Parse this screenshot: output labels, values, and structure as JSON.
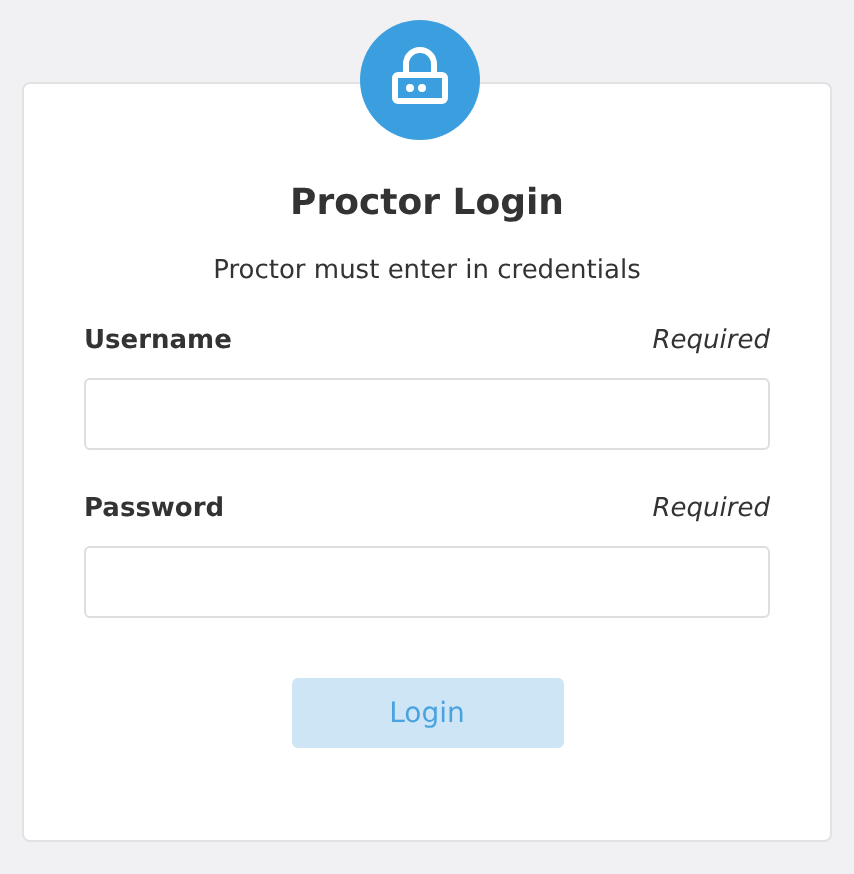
{
  "title": "Proctor Login",
  "subtitle": "Proctor must enter in credentials",
  "fields": [
    {
      "label": "Username",
      "hint": "Required"
    },
    {
      "label": "Password",
      "hint": "Required"
    }
  ],
  "login_button": {
    "label": "Login",
    "disabled": true
  }
}
